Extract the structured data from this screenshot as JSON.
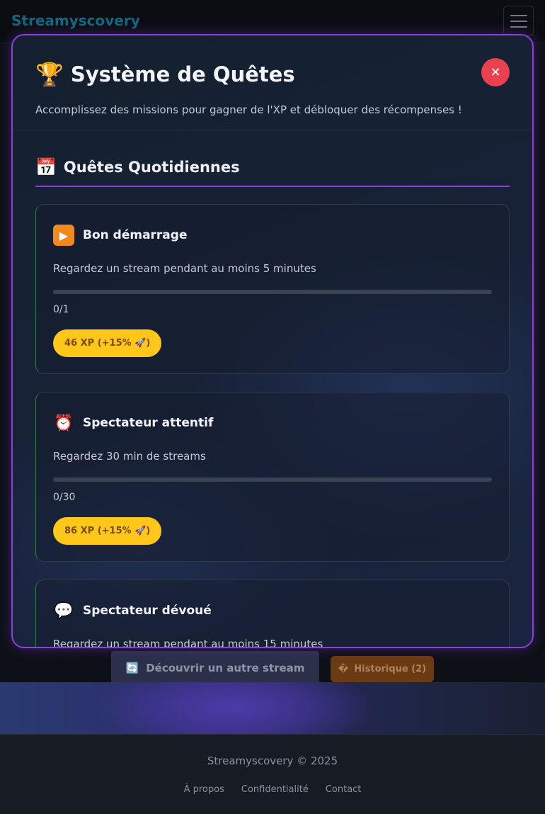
{
  "navbar": {
    "brand": "Streamyscovery",
    "menu_icon": "hamburger-menu-icon"
  },
  "modal": {
    "title": "Système de Quêtes",
    "title_icon": "🏆",
    "subtitle": "Accomplissez des missions pour gagner de l'XP et débloquer des récompenses !",
    "close_label": "✕",
    "section": {
      "icon": "📅",
      "title": "Quêtes Quotidiennes"
    },
    "quests": [
      {
        "icon": "▶",
        "icon_name": "play-icon",
        "name": "Bon démarrage",
        "description": "Regardez un stream pendant au moins 5 minutes",
        "progress_text": "0/1",
        "progress": 0,
        "reward": "46 XP (+15% 🚀)"
      },
      {
        "icon": "⏰",
        "icon_name": "alarm-clock-icon",
        "name": "Spectateur attentif",
        "description": "Regardez 30 min de streams",
        "progress_text": "0/30",
        "progress": 0,
        "reward": "86 XP (+15% 🚀)"
      },
      {
        "icon": "💬",
        "icon_name": "speech-bubble-icon",
        "name": "Spectateur dévoué",
        "description": "Regardez un stream pendant au moins 15 minutes",
        "progress_text": "",
        "progress": 0,
        "reward": ""
      }
    ]
  },
  "actions": {
    "discover_icon": "🔄",
    "discover_label": "Découvrir un autre stream",
    "history_icon": "�",
    "history_label": "Historique (2)"
  },
  "footer": {
    "copyright": "Streamyscovery © 2025",
    "links": [
      "À propos",
      "Confidentialité",
      "Contact"
    ]
  },
  "colors": {
    "accent_purple": "#8a3fe0",
    "brand_cyan": "#17a2c7",
    "close_red": "#e8414f",
    "xp_yellow": "#ffc71a",
    "history_orange": "#6b3a12"
  }
}
